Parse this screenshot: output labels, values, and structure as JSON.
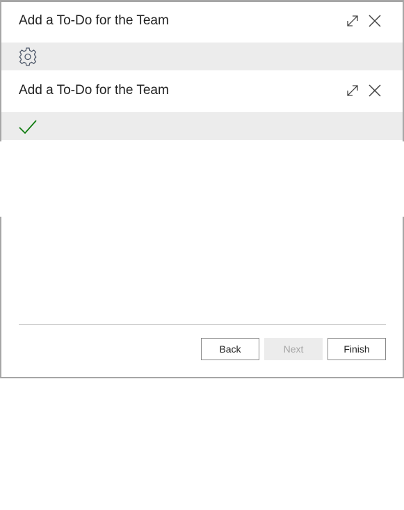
{
  "dialog_1": {
    "title": "Add a To-Do for the Team",
    "status_icon": "gear-icon"
  },
  "dialog_2": {
    "title": "Add a To-Do for the Team",
    "status_icon": "checkmark-icon"
  },
  "header_icons": [
    "expand-icon",
    "close-icon"
  ],
  "footer": {
    "back_label": "Back",
    "next_label": "Next",
    "finish_label": "Finish"
  },
  "colors": {
    "band": "#ececec",
    "checkmark": "#107c10",
    "disabled_text": "#a6a6a6"
  }
}
